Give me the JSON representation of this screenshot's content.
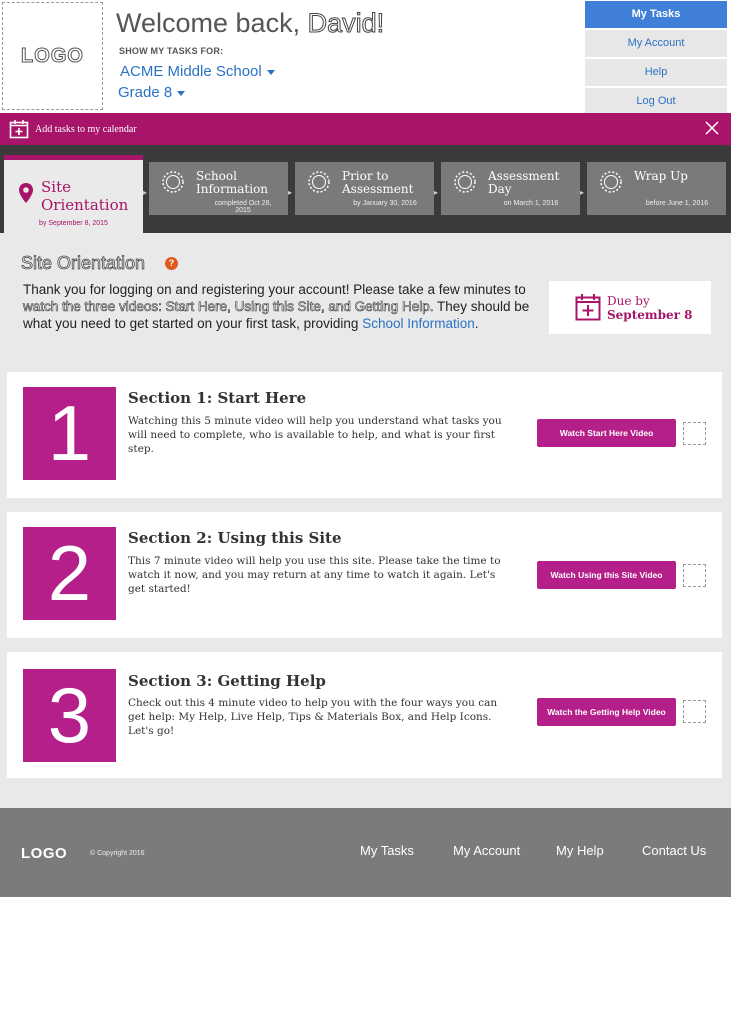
{
  "header": {
    "logo_text": "LOGO",
    "welcome_prefix": "Welcome back, ",
    "welcome_name": "David!",
    "show_tasks_label": "SHOW MY TASKS FOR:",
    "school": "ACME Middle School",
    "grade": "Grade 8"
  },
  "topnav": {
    "items": [
      {
        "label": "My Tasks",
        "active": true
      },
      {
        "label": "My Account",
        "active": false
      },
      {
        "label": "Help",
        "active": false
      },
      {
        "label": "Log Out",
        "active": false
      }
    ]
  },
  "calendar_bar": {
    "label": "Add tasks to my calendar"
  },
  "steps": [
    {
      "title": "Site Orientation",
      "date": "by September 8, 2015",
      "active": true
    },
    {
      "title": "School Information",
      "date": "completed Oct 28, 2015",
      "active": false
    },
    {
      "title": "Prior to Assessment",
      "date": "by January 30, 2016",
      "active": false
    },
    {
      "title": "Assessment Day",
      "date": "on March 1, 2016",
      "active": false
    },
    {
      "title": "Wrap Up",
      "date": "before June 1, 2016",
      "active": false
    }
  ],
  "content": {
    "title": "Site Orientation",
    "help_icon": "?",
    "intro_start": "Thank you for logging on and registering your account! Please take a few minutes to ",
    "intro_highlight": "watch the three videos: Start Here, Using this Site, and Getting Help.",
    "intro_middle": " They should be what you need to get started on your first task, providing ",
    "intro_link": "School Information",
    "intro_end": ".",
    "due_label": "Due by",
    "due_date": "September 8"
  },
  "sections": [
    {
      "number": "1",
      "title": "Section 1: Start Here",
      "description": "Watching this 5 minute video will help you understand what tasks you will need to complete, who is available to help, and what is your first step.",
      "button": "Watch Start Here Video"
    },
    {
      "number": "2",
      "title": "Section 2: Using this Site",
      "description": "This 7 minute video will help you use this site. Please take the time to watch it now, and you may return at any time to watch it again. Let's get started!",
      "button": "Watch Using this Site Video"
    },
    {
      "number": "3",
      "title": "Section 3: Getting Help",
      "description": "Check out this 4 minute video to help you with the four ways you can get help: My Help, Live Help, Tips & Materials Box, and Help Icons. Let's go!",
      "button": "Watch the Getting Help Video"
    }
  ],
  "footer": {
    "logo": "LOGO",
    "copyright": "© Copyright 2016",
    "links": [
      "My Tasks",
      "My Account",
      "My Help",
      "Contact Us"
    ]
  },
  "colors": {
    "brand_magenta": "#a71469",
    "section_number_bg": "#b51f8a",
    "active_nav_blue": "#3f7fd8",
    "link_blue": "#2a72c4",
    "help_orange": "#e05a1c"
  }
}
